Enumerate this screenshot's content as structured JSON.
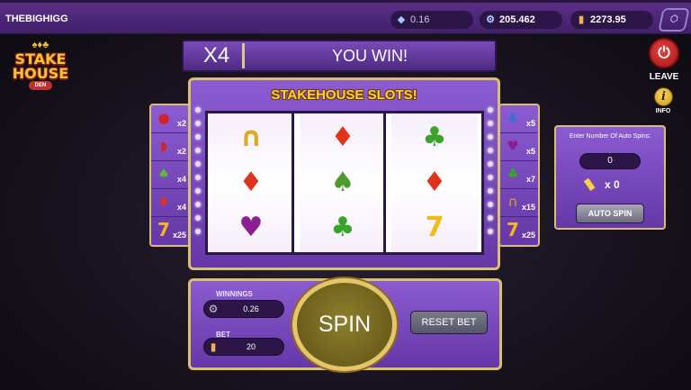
{
  "header": {
    "username": "THEBIGHIGG",
    "balances": [
      {
        "icon": "gem-icon",
        "value": "0.16"
      },
      {
        "icon": "bike-icon",
        "value": "205.462"
      },
      {
        "icon": "bottle-icon",
        "value": "2273.95"
      }
    ],
    "menu_icon": "hex-menu-icon"
  },
  "logo": {
    "line1": "STAKE",
    "line2": "HOUSE",
    "line3": "DEN"
  },
  "side_buttons": {
    "leave_label": "LEAVE",
    "info_label": "INFO",
    "info_glyph": "i",
    "leave_glyph": "⏻"
  },
  "result": {
    "multiplier": "X4",
    "message": "YOU WIN!"
  },
  "machine": {
    "title": "STAKEHOUSE SLOTS!",
    "reels": [
      [
        {
          "name": "horseshoe",
          "glyph": "∩",
          "color": "#e0a91c"
        },
        {
          "name": "diamond",
          "glyph": "♦",
          "color": "#e0331b"
        },
        {
          "name": "heart",
          "glyph": "♥",
          "color": "#8a1f8f"
        }
      ],
      [
        {
          "name": "diamond",
          "glyph": "♦",
          "color": "#e0331b"
        },
        {
          "name": "spade",
          "glyph": "♠",
          "color": "#4f9a2f"
        },
        {
          "name": "clover",
          "glyph": "♣",
          "color": "#3aa32c"
        }
      ],
      [
        {
          "name": "clover",
          "glyph": "♣",
          "color": "#3aa32c"
        },
        {
          "name": "diamond",
          "glyph": "♦",
          "color": "#e0331b"
        },
        {
          "name": "seven",
          "glyph": "7",
          "color": "#f3b81a"
        }
      ]
    ]
  },
  "payout_left": [
    {
      "name": "cherry",
      "glyph": "●",
      "color": "#d3232a",
      "mult": "x2"
    },
    {
      "name": "watermelon",
      "glyph": "◗",
      "color": "#d3232a",
      "mult": "x2"
    },
    {
      "name": "spade",
      "glyph": "♠",
      "color": "#5bbb3a",
      "mult": "x4"
    },
    {
      "name": "diamond",
      "glyph": "♦",
      "color": "#e0331b",
      "mult": "x4"
    },
    {
      "name": "seven",
      "glyph": "7",
      "color": "#f3b81a",
      "mult": "x25"
    }
  ],
  "payout_right": [
    {
      "name": "club",
      "glyph": "♣",
      "color": "#3b6fd6",
      "mult": "x5"
    },
    {
      "name": "heart",
      "glyph": "♥",
      "color": "#8a1f8f",
      "mult": "x5"
    },
    {
      "name": "clover",
      "glyph": "♣",
      "color": "#3aa32c",
      "mult": "x7"
    },
    {
      "name": "horseshoe",
      "glyph": "∩",
      "color": "#e0a91c",
      "mult": "x15"
    },
    {
      "name": "seven",
      "glyph": "7",
      "color": "#f3b81a",
      "mult": "x25"
    }
  ],
  "auto": {
    "title": "Enter Number Of Auto Spins:",
    "value": "0",
    "count": "x 0",
    "button": "AUTO SPIN"
  },
  "controls": {
    "winnings_label": "WINNINGS",
    "winnings_value": "0.26",
    "bet_label": "BET",
    "bet_value": "20",
    "spin": "SPIN",
    "reset": "RESET BET"
  }
}
